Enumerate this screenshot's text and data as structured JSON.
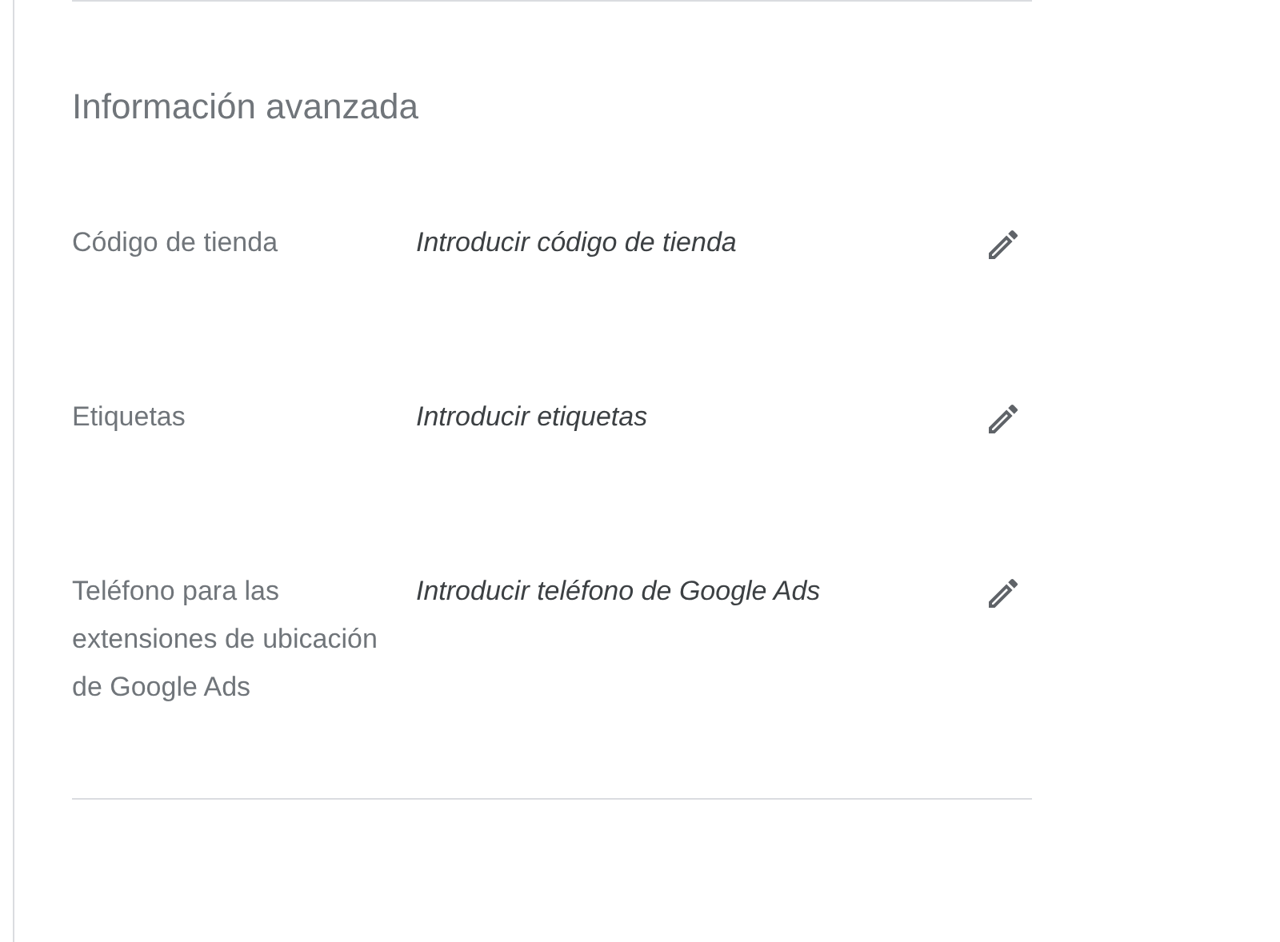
{
  "section": {
    "title": "Información avanzada",
    "fields": [
      {
        "label": "Código de tienda",
        "placeholder": "Introducir código de tienda"
      },
      {
        "label": "Etiquetas",
        "placeholder": "Introducir etiquetas"
      },
      {
        "label": "Teléfono para las extensiones de ubicación de Google Ads",
        "placeholder": "Introducir teléfono de Google Ads"
      }
    ]
  }
}
